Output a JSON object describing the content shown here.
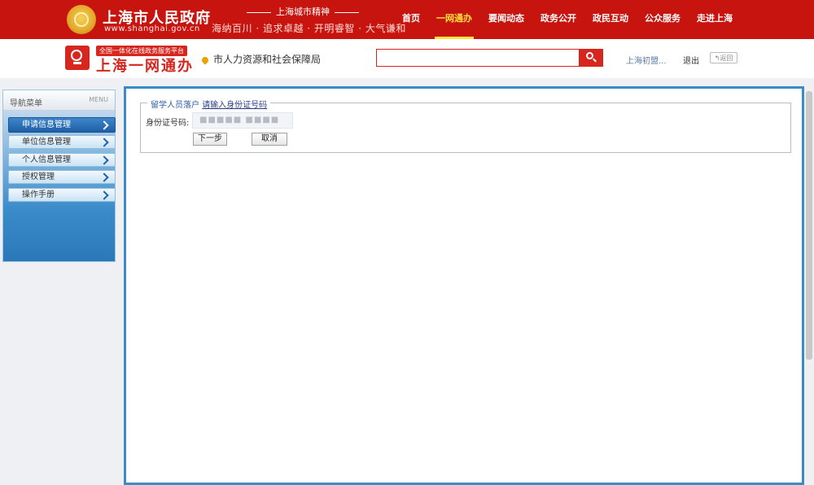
{
  "header": {
    "gov_name": "上海市人民政府",
    "gov_url": "www.shanghai.gov.cn",
    "spirit_title": "上海城市精神",
    "spirit_motto": "海纳百川 · 追求卓越 · 开明睿智 · 大气谦和",
    "nav": [
      {
        "label": "首页"
      },
      {
        "label": "一网通办"
      },
      {
        "label": "要闻动态"
      },
      {
        "label": "政务公开"
      },
      {
        "label": "政民互动"
      },
      {
        "label": "公众服务"
      },
      {
        "label": "走进上海"
      }
    ],
    "active_nav": "一网通办",
    "brand_color": "#c8140f"
  },
  "subheader": {
    "platform_tag": "全国一体化在线政务服务平台",
    "brand": "上海一网通办",
    "department": "市人力资源和社会保障局",
    "search_placeholder": "",
    "user": "上海初盟...",
    "logout": "退出",
    "back": "返回"
  },
  "sidebar": {
    "title": "导航菜单",
    "menu_label": "MENU",
    "items": [
      {
        "label": "申请信息管理",
        "active": true
      },
      {
        "label": "单位信息管理"
      },
      {
        "label": "个人信息管理"
      },
      {
        "label": "授权管理"
      },
      {
        "label": "操作手册"
      }
    ]
  },
  "form": {
    "legend_bold": "留学人员落户",
    "legend_hint": "请输入身份证号码",
    "id_label": "身份证号码:",
    "id_value": "■■■■■ ■■■■",
    "next_button": "下一步",
    "cancel_button": "取消"
  }
}
